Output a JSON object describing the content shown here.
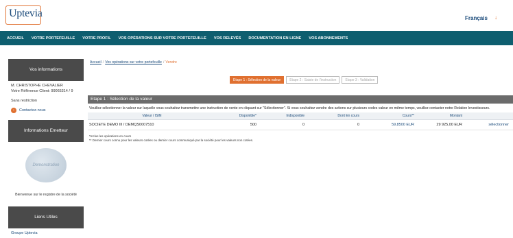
{
  "header": {
    "logo_text": "Uptevia",
    "logo_sub": "",
    "language": "Français"
  },
  "nav": {
    "items": [
      "ACCUEIL",
      "VOTRE PORTEFEUILLE",
      "VOTRE PROFIL",
      "VOS OPÉRATIONS SUR VOTRE PORTEFEUILLE",
      "VOS RELEVÉS",
      "DOCUMENTATION EN LIGNE",
      "VOS ABONNEMENTS"
    ]
  },
  "sidebar": {
    "info_title": "Vos informations",
    "holder_name": "M. CHRISTOPHE CHEVALIER",
    "client_ref": "Votre Référence Client: 99065314 / 9",
    "restriction": "Sans restriction",
    "contact_label": "Contactez-nous",
    "issuer_title": "Informations Emetteur",
    "demo_label": "Demonstration",
    "welcome_text": "Bienvenue sur le registre de la société",
    "links_title": "Liens Utiles",
    "group_link": "Groupe Uptevia"
  },
  "breadcrumb": {
    "home": "Accueil",
    "ops": "Vos opérations sur votre portefeuille",
    "current": "Vendre"
  },
  "steps": [
    {
      "label": "Etape 1 : Sélection de la valeur",
      "active": true
    },
    {
      "label": "Etape 2 : Saisie de l'instruction",
      "active": false
    },
    {
      "label": "Etape 3 : Validation",
      "active": false
    }
  ],
  "panel": {
    "title": "Etape 1 : Sélection de la valeur",
    "instruction": "Veuillez sélectionner la valeur sur laquelle vous souhaitez transmettre une instruction de vente en cliquant sur \"Sélectionner\". Si vous souhaitez vendre des actions sur plusieurs codes valeur en même temps, veuillez contacter notre Relation Investisseurs."
  },
  "table": {
    "headers": {
      "valeur": "Valeur / ISIN",
      "disponible": "Disponible*",
      "indisponible": "Indisponible",
      "encours": "Dont En cours",
      "cours": "Cours**",
      "montant": "Montant"
    },
    "rows": [
      {
        "valeur": "SOCIETE DEMO III / DEMQS0007510",
        "disponible": "500",
        "indisponible": "0",
        "encours": "0",
        "cours": "59,8500 EUR",
        "montant": "29 925,00 EUR",
        "action": "sélectionner"
      }
    ]
  },
  "footnotes": {
    "line1": "*Inclus les opérations en cours",
    "line2": "** Dernier cours connu pour les valeurs cotées ou dernier cours communiqué par la société pour les valeurs non cotées."
  },
  "colors": {
    "brand_teal": "#0e5e6f",
    "accent_orange": "#e07030",
    "link_blue": "#1a4a7a"
  }
}
